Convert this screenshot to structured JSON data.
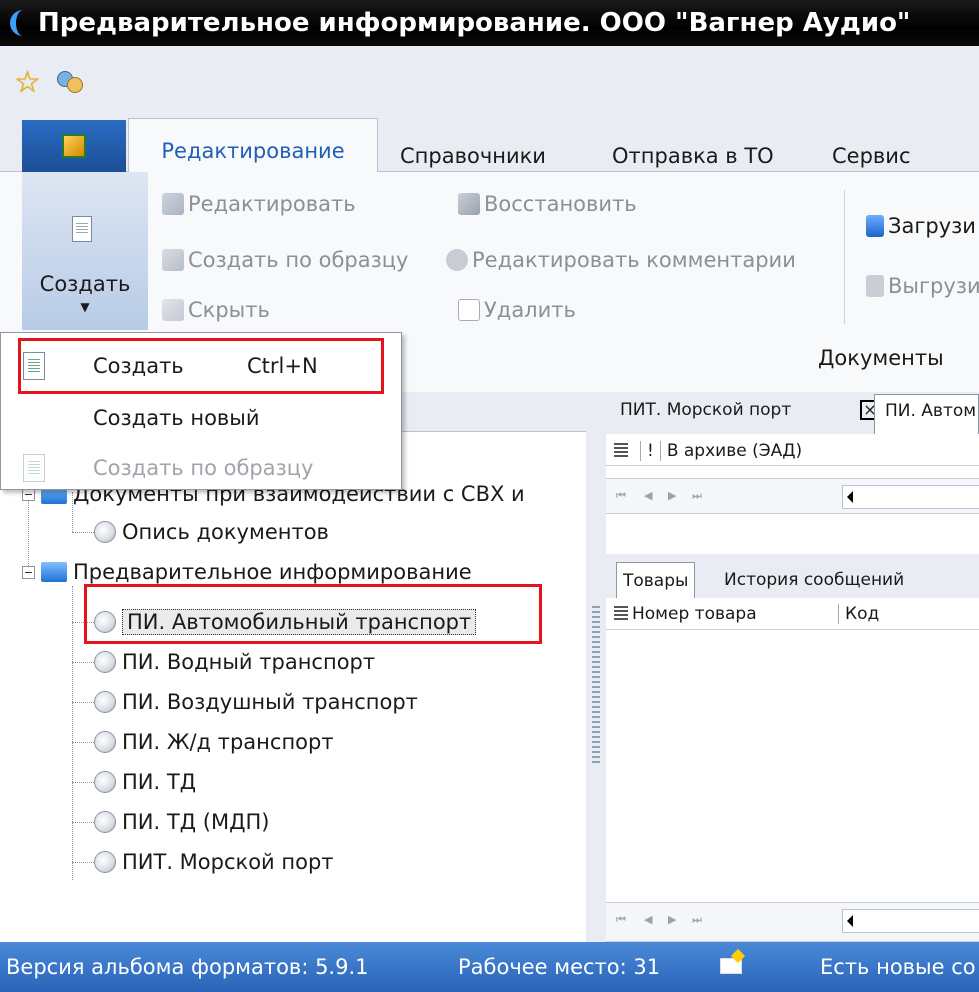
{
  "window": {
    "title": "Предварительное информирование. ООО \"Вагнер Аудио\""
  },
  "quick_access": {
    "icons": [
      "star-icon",
      "users-icon"
    ]
  },
  "ribbon": {
    "tabs": [
      {
        "label": "Редактирование",
        "active": true
      },
      {
        "label": "Справочники"
      },
      {
        "label": "Отправка в ТО"
      },
      {
        "label": "Сервис"
      }
    ],
    "create_button": "Создать",
    "edit": "Редактировать",
    "create_by_sample": "Создать по образцу",
    "hide": "Скрыть",
    "restore": "Восстановить",
    "edit_comments": "Редактировать комментарии",
    "delete": "Удалить",
    "load": "Загрузи",
    "unload": "Выгрузи",
    "group_documents": "Документы"
  },
  "dropdown": {
    "items": [
      {
        "label": "Создать",
        "shortcut": "Ctrl+N",
        "enabled": true
      },
      {
        "label": "Создать новый",
        "enabled": true
      },
      {
        "label": "Создать по образцу",
        "enabled": false
      }
    ]
  },
  "tree": {
    "groups": [
      {
        "label": "Документы при взаимодействии с СВХ и",
        "children": [
          "Опись документов"
        ]
      },
      {
        "label": "Предварительное информирование",
        "children": [
          "ПИ. Автомобильный транспорт",
          "ПИ. Водный транспорт",
          "ПИ. Воздушный транспорт",
          "ПИ. Ж/д транспорт",
          "ПИ. ТД",
          "ПИ. ТД (МДП)",
          "ПИТ. Морской порт"
        ]
      }
    ],
    "selected": "ПИ. Автомобильный транспорт"
  },
  "right_panel": {
    "doc_tabs": [
      "ПИТ. Морской порт",
      "ПИ. Автом"
    ],
    "grid_columns": [
      "!",
      "В архиве (ЭАД)"
    ],
    "bottom_tabs": [
      "Товары",
      "История сообщений"
    ],
    "bottom_grid_columns": [
      "Номер товара",
      "Код"
    ]
  },
  "status": {
    "format_version": "Версия альбома форматов: 5.9.1",
    "workplace": "Рабочее место: 31",
    "messages": "Есть новые со"
  },
  "colors": {
    "highlight": "#e3141b",
    "accent": "#1f5fb6",
    "status_bar": "#2a64b8"
  }
}
